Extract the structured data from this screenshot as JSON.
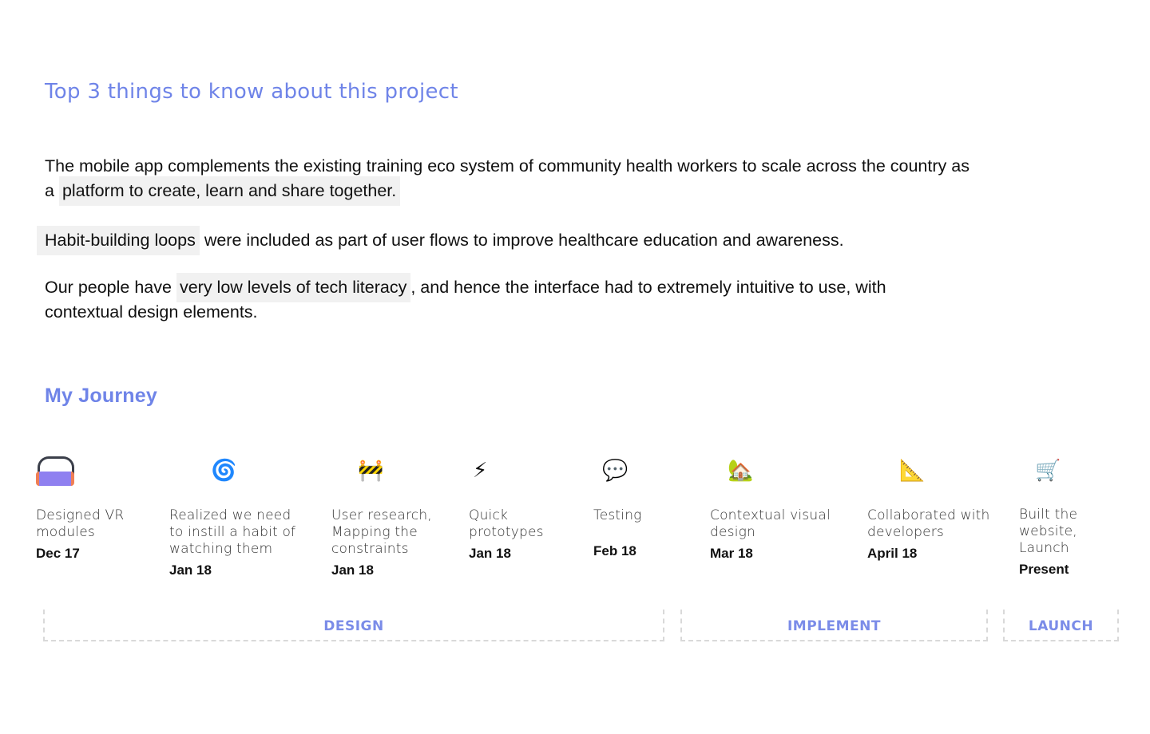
{
  "headings": {
    "top3": "Top 3 things to know about this project",
    "journey": "My Journey"
  },
  "points": [
    {
      "before": "The mobile app complements the existing training eco system of community health workers to scale across the country as a ",
      "highlight": "platform to create, learn and share together.",
      "after": ""
    },
    {
      "before": "",
      "highlight": "Habit-building loops",
      "after": " were included as part of user flows to improve healthcare education and awareness."
    },
    {
      "before": "Our people have ",
      "highlight": "very low levels of tech literacy",
      "after": ", and hence the interface had to extremely  intuitive to use, with contextual design elements."
    }
  ],
  "journey": [
    {
      "icon": "vr-headset-icon",
      "label": "Designed VR modules",
      "date": "Dec 17"
    },
    {
      "icon": "spiral-icon",
      "glyph": "🌀",
      "label": "Realized we need to instill a habit of watching them",
      "date": "Jan 18"
    },
    {
      "icon": "construction-barrier-icon",
      "glyph": "🚧",
      "label": "User research, Mapping the constraints",
      "date": "Jan 18"
    },
    {
      "icon": "lightning-icon",
      "glyph": "⚡",
      "label": "Quick prototypes",
      "date": "Jan 18"
    },
    {
      "icon": "speech-bubble-icon",
      "glyph": "💬",
      "label": "Testing",
      "date": "Feb 18"
    },
    {
      "icon": "house-garden-icon",
      "glyph": "🏡",
      "label": "Contextual visual design",
      "date": "Mar 18"
    },
    {
      "icon": "triangle-ruler-icon",
      "glyph": "📐",
      "label": "Collaborated with developers",
      "date": "April 18"
    },
    {
      "icon": "shopping-cart-icon",
      "glyph": "🛒",
      "label": "Built the website, Launch",
      "date": "Present"
    }
  ],
  "phases": [
    "DESIGN",
    "IMPLEMENT",
    "LAUNCH"
  ],
  "colors": {
    "accent": "#6f84e8",
    "highlight_bg": "#f1f1f1",
    "phase_text": "#7b8ce8"
  }
}
